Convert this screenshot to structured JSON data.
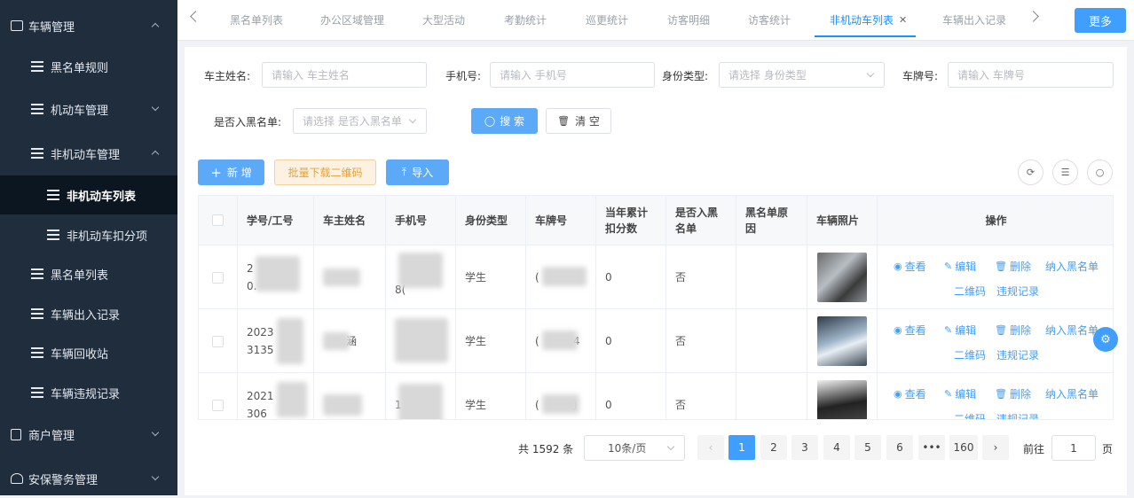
{
  "sidebar": {
    "group_vehicle": "车辆管理",
    "items": [
      {
        "label": "黑名单规则"
      },
      {
        "label": "机动车管理"
      },
      {
        "label": "非机动车管理"
      },
      {
        "label": "非机动车列表"
      },
      {
        "label": "非机动车扣分项"
      },
      {
        "label": "黑名单列表"
      },
      {
        "label": "车辆出入记录"
      },
      {
        "label": "车辆回收站"
      },
      {
        "label": "车辆违规记录"
      }
    ],
    "group_merchant": "商户管理",
    "group_security": "安保警务管理"
  },
  "tabs": [
    {
      "label": "黑名单列表"
    },
    {
      "label": "办公区域管理"
    },
    {
      "label": "大型活动"
    },
    {
      "label": "考勤统计"
    },
    {
      "label": "巡更统计"
    },
    {
      "label": "访客明细"
    },
    {
      "label": "访客统计"
    },
    {
      "label": "非机动车列表"
    },
    {
      "label": "车辆出入记录"
    }
  ],
  "more_label": "更多",
  "filters": {
    "owner_label": "车主姓名:",
    "owner_placeholder": "请输入 车主姓名",
    "phone_label": "手机号:",
    "phone_placeholder": "请输入 手机号",
    "idtype_label": "身份类型:",
    "idtype_placeholder": "请选择 身份类型",
    "plate_label": "车牌号:",
    "plate_placeholder": "请输入 车牌号",
    "blacklist_label": "是否入黑名单:",
    "blacklist_placeholder": "请选择 是否入黑名单",
    "search_label": "搜 索",
    "clear_label": "清 空"
  },
  "toolbar": {
    "add_label": "新 增",
    "batch_qr_label": "批量下载二维码",
    "import_label": "导入"
  },
  "table": {
    "headers": [
      "学号/工号",
      "车主姓名",
      "手机号",
      "身份类型",
      "车牌号",
      "当年累计扣分数",
      "是否入黑名单",
      "黑名单原因",
      "车辆照片",
      "操作"
    ],
    "rows": [
      {
        "id_a": "2",
        "id_b": "0.",
        "name": "",
        "phone": "8(",
        "type": "学生",
        "plate": "(",
        "points": "0",
        "black": "否"
      },
      {
        "id_a": "2023",
        "id_b": "3135",
        "name": "涵",
        "phone": "",
        "type": "学生",
        "plate": "(          4",
        "points": "0",
        "black": "否"
      },
      {
        "id_a": "2021",
        "id_b": "306",
        "name": "",
        "phone": "1",
        "type": "学生",
        "plate": "(          )",
        "points": "0",
        "black": "否"
      }
    ],
    "ops": {
      "view": "查看",
      "edit": "编辑",
      "delete": "删除",
      "blacklist": "纳入黑名单",
      "qrcode": "二维码",
      "violation": "违规记录"
    }
  },
  "pagination": {
    "total": "共 1592 条",
    "page_size": "10条/页",
    "pages": [
      "1",
      "2",
      "3",
      "4",
      "5",
      "6",
      "•••",
      "160"
    ],
    "goto_label": "前往",
    "goto_value": "1",
    "page_unit": "页"
  }
}
